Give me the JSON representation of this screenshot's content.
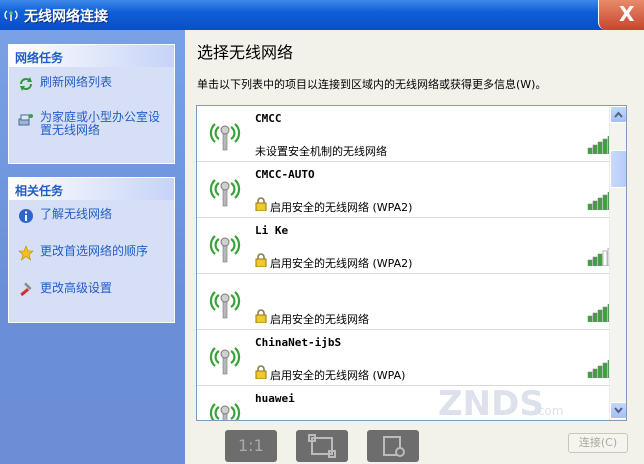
{
  "window": {
    "title": "无线网络连接",
    "close_glyph": "X"
  },
  "sidebar": {
    "panels": [
      {
        "title": "网络任务",
        "items": [
          {
            "label": "刷新网络列表",
            "icon": "refresh-icon"
          },
          {
            "label": "为家庭或小型办公室设置无线网络",
            "icon": "network-setup-icon"
          }
        ]
      },
      {
        "title": "相关任务",
        "items": [
          {
            "label": "了解无线网络",
            "icon": "info-icon"
          },
          {
            "label": "更改首选网络的顺序",
            "icon": "star-icon"
          },
          {
            "label": "更改高级设置",
            "icon": "tools-icon"
          }
        ]
      }
    ]
  },
  "main": {
    "title": "选择无线网络",
    "hint": "单击以下列表中的项目以连接到区域内的无线网络或获得更多信息(W)。",
    "networks": [
      {
        "ssid": "CMCC",
        "security": "未设置安全机制的无线网络",
        "locked": false,
        "signal_bars": 5
      },
      {
        "ssid": "CMCC-AUTO",
        "security": "启用安全的无线网络 (WPA2)",
        "locked": true,
        "signal_bars": 5
      },
      {
        "ssid": "Li Ke",
        "security": "启用安全的无线网络 (WPA2)",
        "locked": true,
        "signal_bars": 3
      },
      {
        "ssid": "",
        "security": "启用安全的无线网络",
        "locked": true,
        "signal_bars": 5
      },
      {
        "ssid": "ChinaNet-ijbS",
        "security": "启用安全的无线网络 (WPA)",
        "locked": true,
        "signal_bars": 5
      },
      {
        "ssid": "huawei",
        "security": "",
        "locked": false,
        "signal_bars": 0
      }
    ],
    "connect_label": "连接(C)",
    "zoom_label": "1:1"
  },
  "watermark": {
    "text": "ZNDS",
    "suffix": ".com"
  },
  "colors": {
    "title_blue": "#0a4ec8",
    "link_blue": "#215dc6",
    "signal_green": "#3aa23a",
    "panel_bg": "#d6dff5"
  }
}
